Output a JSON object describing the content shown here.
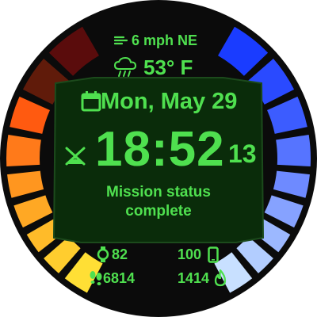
{
  "colors": {
    "accent": "#4fe04f",
    "bezel": "#0b0b0b",
    "panel": "#0a2c0a",
    "panel_edge": "#1c4a1c"
  },
  "weather": {
    "wind": "6 mph NE",
    "temperature": "53° F",
    "wind_icon": "wind-icon",
    "condition_icon": "cloud-rain-icon"
  },
  "date": {
    "text": "Mon, May 29",
    "icon": "calendar-icon"
  },
  "time": {
    "hours_minutes": "18:52",
    "seconds": "13",
    "left_icon": "spark-icon"
  },
  "status": {
    "line1": "Mission status",
    "line2": "complete"
  },
  "stats": {
    "heart_rate": "82",
    "battery": "100",
    "steps": "6814",
    "calories": "1414"
  },
  "left_gauge_level": 0.75,
  "right_gauge_level": 1.0,
  "left_gauge_colors": [
    "#5a0c0c",
    "#ff3a0a",
    "#ff5a10",
    "#ff7a1a",
    "#ff961f",
    "#ffa824",
    "#ffbb29",
    "#ffcd2e",
    "#ffdf35"
  ],
  "right_gauge_colors": [
    "#1a3cff",
    "#2a4aff",
    "#3c5cff",
    "#5674ff",
    "#6e8aff",
    "#86a2ff",
    "#9cb8ff",
    "#b2cdff",
    "#c8e0ff"
  ]
}
